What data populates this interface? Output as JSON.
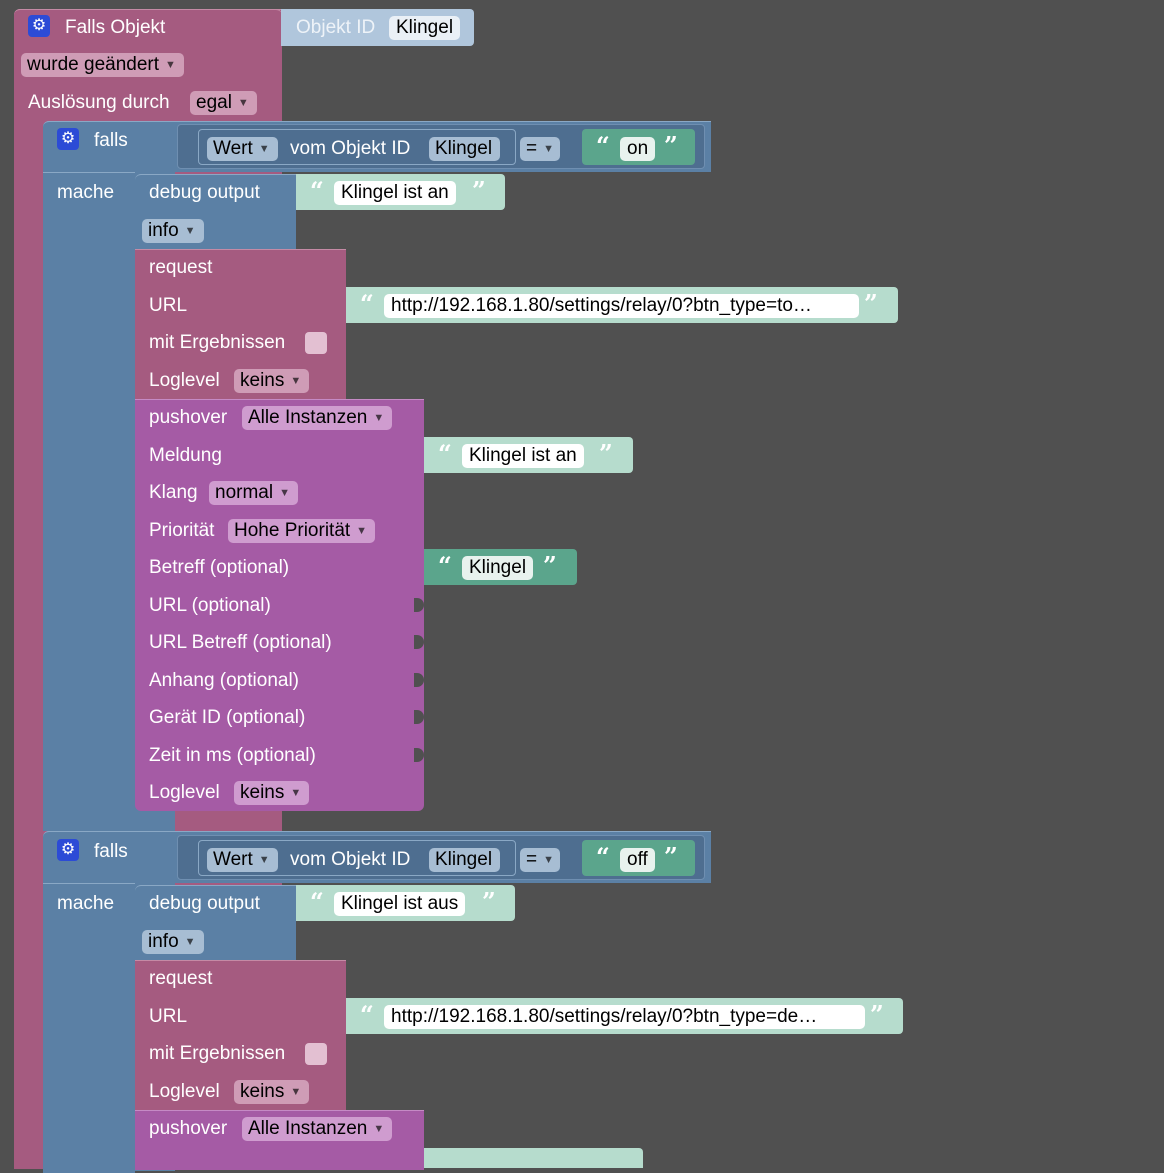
{
  "trigger": {
    "title": "Falls Objekt",
    "event": "wurde geändert",
    "trigger_label": "Auslösung durch",
    "trigger_value": "egal",
    "objid_label": "Objekt ID",
    "objid_value": "Klingel"
  },
  "branches": [
    {
      "if_label": "falls",
      "do_label": "mache",
      "cond": {
        "mode": "Wert",
        "text": "vom Objekt ID",
        "obj": "Klingel",
        "op": "=",
        "value": "on"
      },
      "debug": {
        "label": "debug output",
        "level": "info",
        "text": "Klingel ist an"
      },
      "request": {
        "title": "request",
        "url_label": "URL",
        "url": "http://192.168.1.80/settings/relay/0?btn_type=to…",
        "results_label": "mit Ergebnissen",
        "loglevel_label": "Loglevel",
        "loglevel": "keins"
      },
      "pushover": {
        "title": "pushover",
        "instance": "Alle Instanzen",
        "message_label": "Meldung",
        "message": "Klingel ist an",
        "sound_label": "Klang",
        "sound": "normal",
        "priority_label": "Priorität",
        "priority": "Hohe Priorität",
        "subject_label": "Betreff (optional)",
        "subject": "Klingel",
        "url_label": "URL (optional)",
        "url_title_label": "URL Betreff (optional)",
        "attachment_label": "Anhang (optional)",
        "device_label": "Gerät ID (optional)",
        "time_label": "Zeit in ms (optional)",
        "loglevel_label": "Loglevel",
        "loglevel": "keins"
      }
    },
    {
      "if_label": "falls",
      "do_label": "mache",
      "cond": {
        "mode": "Wert",
        "text": "vom Objekt ID",
        "obj": "Klingel",
        "op": "=",
        "value": "off"
      },
      "debug": {
        "label": "debug output",
        "level": "info",
        "text": "Klingel ist aus"
      },
      "request": {
        "title": "request",
        "url_label": "URL",
        "url": "http://192.168.1.80/settings/relay/0?btn_type=de…",
        "results_label": "mit Ergebnissen",
        "loglevel_label": "Loglevel",
        "loglevel": "keins"
      },
      "pushover": {
        "title": "pushover",
        "instance": "Alle Instanzen"
      }
    }
  ],
  "icons": {
    "gear": "gear-icon",
    "caret": "dropdown-caret-icon",
    "quote_open": "“",
    "quote_close": "”"
  },
  "colors": {
    "trigger": "#a55b80",
    "logic": "#5b80a5",
    "pushover": "#a55ba5",
    "text": "#5ba58c",
    "background": "#505050"
  }
}
